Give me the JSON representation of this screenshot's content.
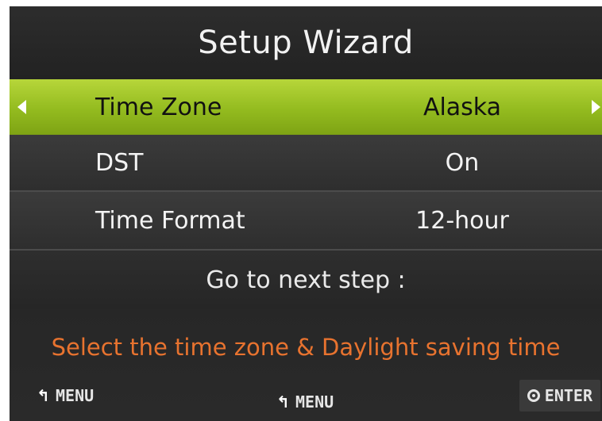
{
  "window": {
    "title": "Setup Wizard"
  },
  "rows": [
    {
      "label": "Time Zone",
      "value": "Alaska",
      "selected": true
    },
    {
      "label": "DST",
      "value": "On",
      "selected": false
    },
    {
      "label": "Time Format",
      "value": "12-hour",
      "selected": false
    }
  ],
  "next_step": {
    "label": "Go to next step :"
  },
  "hint": {
    "text": "Select the time zone & Daylight saving time"
  },
  "footer": {
    "menu_left_label": "MENU",
    "menu_center_label": "MENU",
    "enter_label": "ENTER"
  },
  "colors": {
    "selected_row": "#a6c92c",
    "hint_text": "#e8732f",
    "background": "#252525"
  },
  "icons": {
    "left_arrow": "triangle-left",
    "right_arrow": "triangle-right",
    "menu_back": "return-arrow",
    "enter": "circle-dot"
  }
}
